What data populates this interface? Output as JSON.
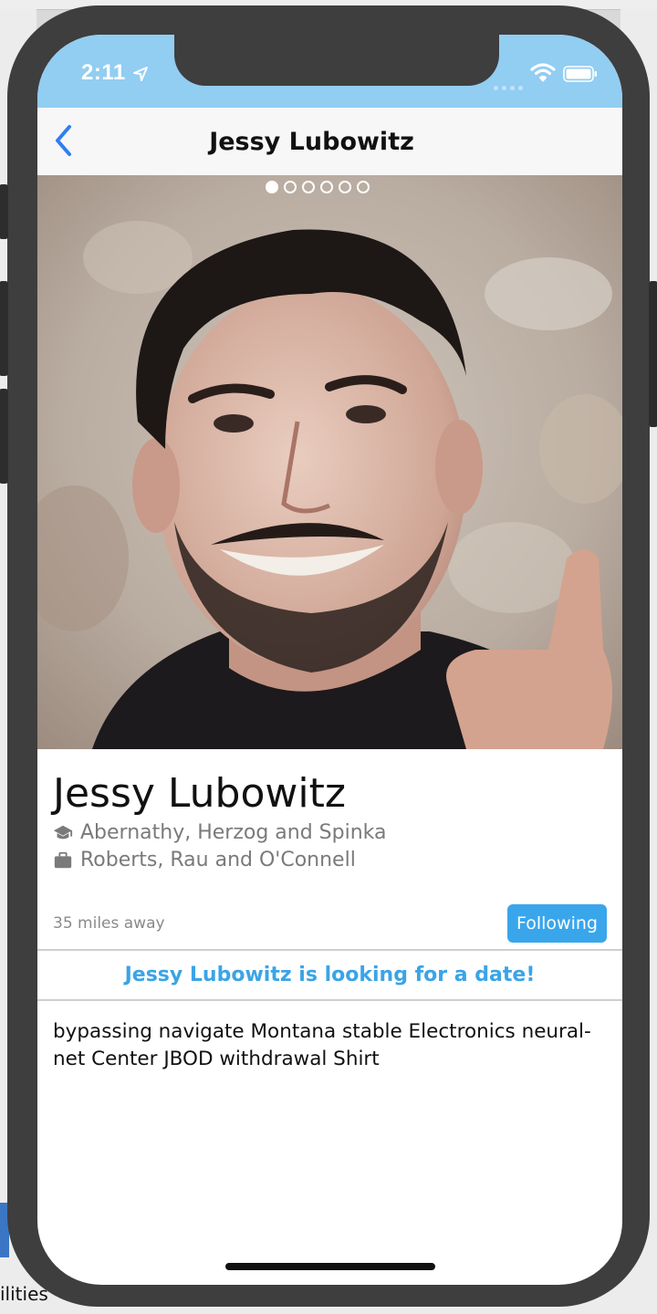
{
  "desktop": {
    "side_label": "ilities"
  },
  "status_bar": {
    "time": "2:11"
  },
  "nav": {
    "title": "Jessy Lubowitz"
  },
  "photo": {
    "page_count": 6,
    "active_page": 1
  },
  "profile": {
    "name": "Jessy Lubowitz",
    "school": "Abernathy, Herzog and Spinka",
    "work": "Roberts, Rau and O'Connell",
    "distance": "35  miles away",
    "follow_label": "Following",
    "looking_text": "Jessy Lubowitz is looking for a date!",
    "bio": "bypassing navigate Montana stable Electronics neural-net Center JBOD withdrawal Shirt"
  },
  "colors": {
    "status_bar": "#92cdf2",
    "accent": "#39a6ec",
    "back_arrow": "#2f7ff0"
  }
}
